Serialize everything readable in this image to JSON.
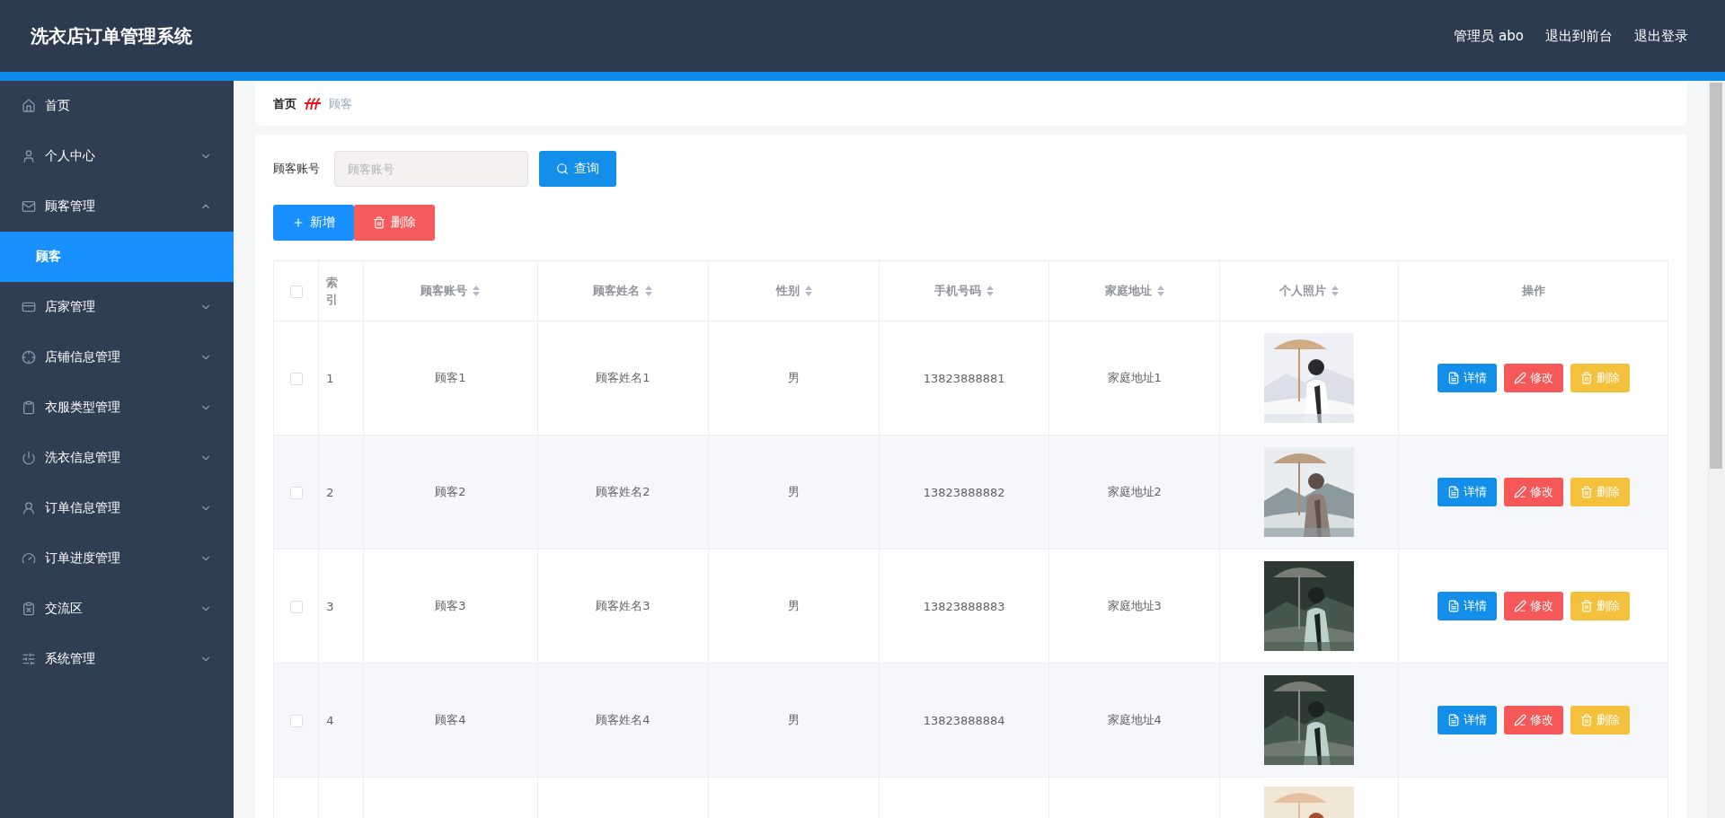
{
  "header": {
    "title": "洗衣店订单管理系统",
    "links": [
      "管理员 abo",
      "退出到前台",
      "退出登录"
    ]
  },
  "sidebar": {
    "items": [
      {
        "label": "首页",
        "kind": "link",
        "selected": false
      },
      {
        "label": "个人中心",
        "kind": "submenu",
        "expanded": false,
        "selected": false
      },
      {
        "label": "顾客管理",
        "kind": "submenu",
        "expanded": true,
        "selected": false,
        "children": [
          {
            "label": "顾客",
            "selected": true
          }
        ]
      },
      {
        "label": "店家管理",
        "kind": "submenu",
        "expanded": false,
        "selected": false
      },
      {
        "label": "店铺信息管理",
        "kind": "submenu",
        "expanded": false,
        "selected": false
      },
      {
        "label": "衣服类型管理",
        "kind": "submenu",
        "expanded": false,
        "selected": false
      },
      {
        "label": "洗衣信息管理",
        "kind": "submenu",
        "expanded": false,
        "selected": false
      },
      {
        "label": "订单信息管理",
        "kind": "submenu",
        "expanded": false,
        "selected": false
      },
      {
        "label": "订单进度管理",
        "kind": "submenu",
        "expanded": false,
        "selected": false
      },
      {
        "label": "交流区",
        "kind": "submenu",
        "expanded": false,
        "selected": false
      },
      {
        "label": "系统管理",
        "kind": "submenu",
        "expanded": false,
        "selected": false
      }
    ]
  },
  "breadcrumb": [
    "首页",
    "顾客"
  ],
  "search": {
    "label": "顾客账号",
    "placeholder": "顾客账号",
    "button": "查询"
  },
  "toolbar": [
    {
      "label": "新增",
      "kind": "add"
    },
    {
      "label": "删除",
      "kind": "delete"
    }
  ],
  "table": {
    "select_all_checked": false,
    "columns": [
      {
        "label": "索引",
        "sortable": false
      },
      {
        "label": "顾客账号",
        "sortable": true
      },
      {
        "label": "顾客姓名",
        "sortable": true
      },
      {
        "label": "性别",
        "sortable": true
      },
      {
        "label": "手机号码",
        "sortable": true
      },
      {
        "label": "家庭地址",
        "sortable": true
      },
      {
        "label": "个人照片",
        "sortable": true
      },
      {
        "label": "操作",
        "sortable": false
      }
    ],
    "rows": [
      {
        "checked": false,
        "cells": [
          "1",
          "顾客1",
          "顾客姓名1",
          "男",
          "13823888881",
          "家庭地址1"
        ],
        "photo": {
          "kind": "picture"
        },
        "actions": [
          {
            "label": "详情",
            "kind": "detail"
          },
          {
            "label": "修改",
            "kind": "edit"
          },
          {
            "label": "删除",
            "kind": "delete"
          }
        ]
      },
      {
        "checked": false,
        "cells": [
          "2",
          "顾客2",
          "顾客姓名2",
          "男",
          "13823888882",
          "家庭地址2"
        ],
        "photo": {
          "kind": "picture"
        },
        "actions": [
          {
            "label": "详情",
            "kind": "detail"
          },
          {
            "label": "修改",
            "kind": "edit"
          },
          {
            "label": "删除",
            "kind": "delete"
          }
        ]
      },
      {
        "checked": false,
        "cells": [
          "3",
          "顾客3",
          "顾客姓名3",
          "男",
          "13823888883",
          "家庭地址3"
        ],
        "photo": {
          "kind": "picture"
        },
        "actions": [
          {
            "label": "详情",
            "kind": "detail"
          },
          {
            "label": "修改",
            "kind": "edit"
          },
          {
            "label": "删除",
            "kind": "delete"
          }
        ]
      },
      {
        "checked": false,
        "cells": [
          "4",
          "顾客4",
          "顾客姓名4",
          "男",
          "13823888884",
          "家庭地址4"
        ],
        "photo": {
          "kind": "picture"
        },
        "actions": [
          {
            "label": "详情",
            "kind": "detail"
          },
          {
            "label": "修改",
            "kind": "edit"
          },
          {
            "label": "删除",
            "kind": "delete"
          }
        ]
      }
    ],
    "partial_row": {
      "photo": {
        "kind": "picture"
      }
    }
  }
}
